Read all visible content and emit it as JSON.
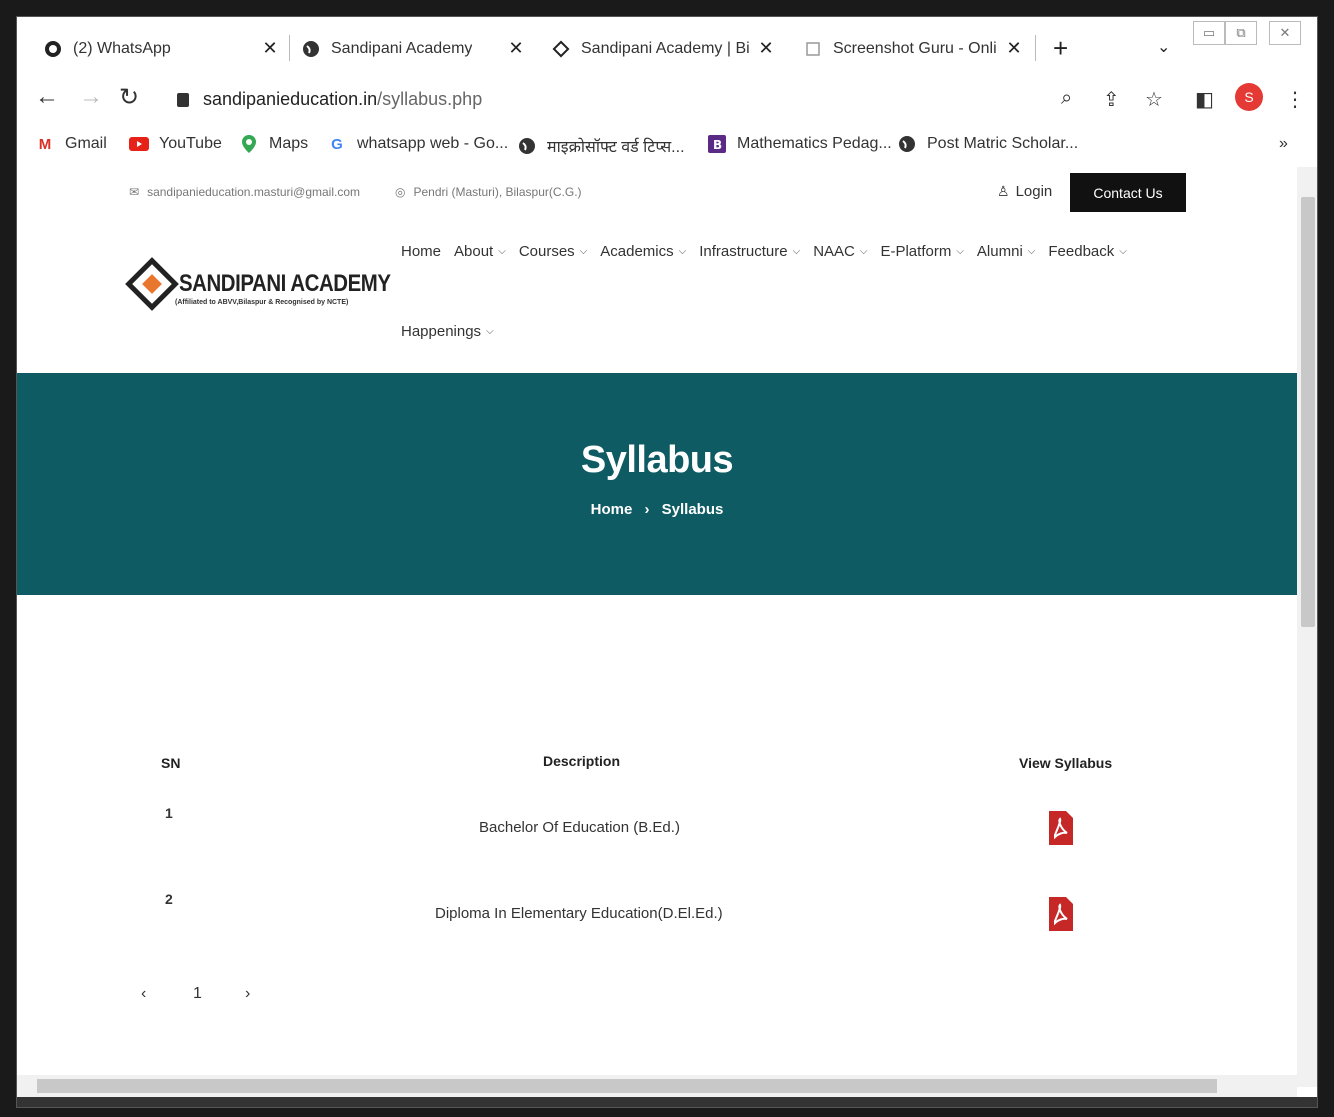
{
  "tabs": [
    {
      "title": "(2) WhatsApp",
      "icon": "whatsapp-icon"
    },
    {
      "title": "Sandipani Academy",
      "icon": "globe-icon"
    },
    {
      "title": "Sandipani Academy | Bila",
      "icon": "diamond-logo-icon"
    },
    {
      "title": "Screenshot Guru - Online",
      "icon": "screenshot-icon"
    }
  ],
  "address": {
    "host": "sandipanieducation.in",
    "path": "/syllabus.php"
  },
  "profile_letter": "S",
  "bookmarks": [
    {
      "label": "Gmail",
      "icon": "gmail-icon"
    },
    {
      "label": "YouTube",
      "icon": "youtube-icon"
    },
    {
      "label": "Maps",
      "icon": "maps-icon"
    },
    {
      "label": "whatsapp web - Go...",
      "icon": "google-icon"
    },
    {
      "label": "माइक्रोसॉफ्ट वर्ड टिप्स...",
      "icon": "globe-icon"
    },
    {
      "label": "Mathematics Pedag...",
      "icon": "bookmark-b-icon"
    },
    {
      "label": "Post Matric Scholar...",
      "icon": "globe-icon"
    }
  ],
  "topbar": {
    "email": "sandipanieducation.masturi@gmail.com",
    "location": "Pendri (Masturi), Bilaspur(C.G.)",
    "login": "Login",
    "contact": "Contact Us"
  },
  "logo": {
    "name": "SANDIPANI ACADEMY",
    "tagline": "(Affiliated to ABVV,Bilaspur & Recognised by NCTE)"
  },
  "nav": {
    "items": [
      "Home",
      "About",
      "Courses",
      "Academics",
      "Infrastructure",
      "NAAC",
      "E-Platform",
      "Alumni",
      "Feedback"
    ],
    "second_row": "Happenings"
  },
  "hero": {
    "title": "Syllabus",
    "crumb_home": "Home",
    "crumb_sep": "›",
    "crumb_current": "Syllabus"
  },
  "table": {
    "headers": [
      "SN",
      "Description",
      "View Syllabus"
    ],
    "rows": [
      {
        "sn": "1",
        "description": "Bachelor Of Education (B.Ed.)"
      },
      {
        "sn": "2",
        "description": "Diploma In Elementary Education(D.El.Ed.)"
      }
    ]
  },
  "pager": {
    "prev": "‹",
    "page": "1",
    "next": "›"
  },
  "colors": {
    "hero_bg": "#0e5b63",
    "pdf_red": "#c62828",
    "contact_bg": "#111111"
  }
}
